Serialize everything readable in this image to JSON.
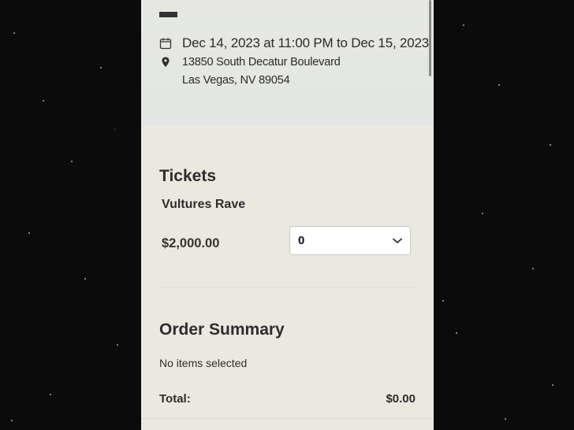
{
  "event": {
    "datetime": "Dec 14, 2023 at 11:00 PM to Dec 15, 2023",
    "address_line1": "13850 South Decatur Boulevard",
    "address_line2": "Las Vegas, NV 89054",
    "date_icon": "calendar-icon",
    "location_icon": "map-pin-icon"
  },
  "tickets": {
    "title": "Tickets",
    "items": [
      {
        "name": "Vultures Rave",
        "price": "$2,000.00",
        "quantity": "0"
      }
    ]
  },
  "order_summary": {
    "title": "Order Summary",
    "empty_text": "No items selected",
    "total_label": "Total:",
    "total_value": "$0.00"
  },
  "colors": {
    "page_background": "#ebe8df",
    "hero_background": "#e5e7e2",
    "text": "#2d2d2d",
    "outer_background": "#0b0b0b"
  }
}
